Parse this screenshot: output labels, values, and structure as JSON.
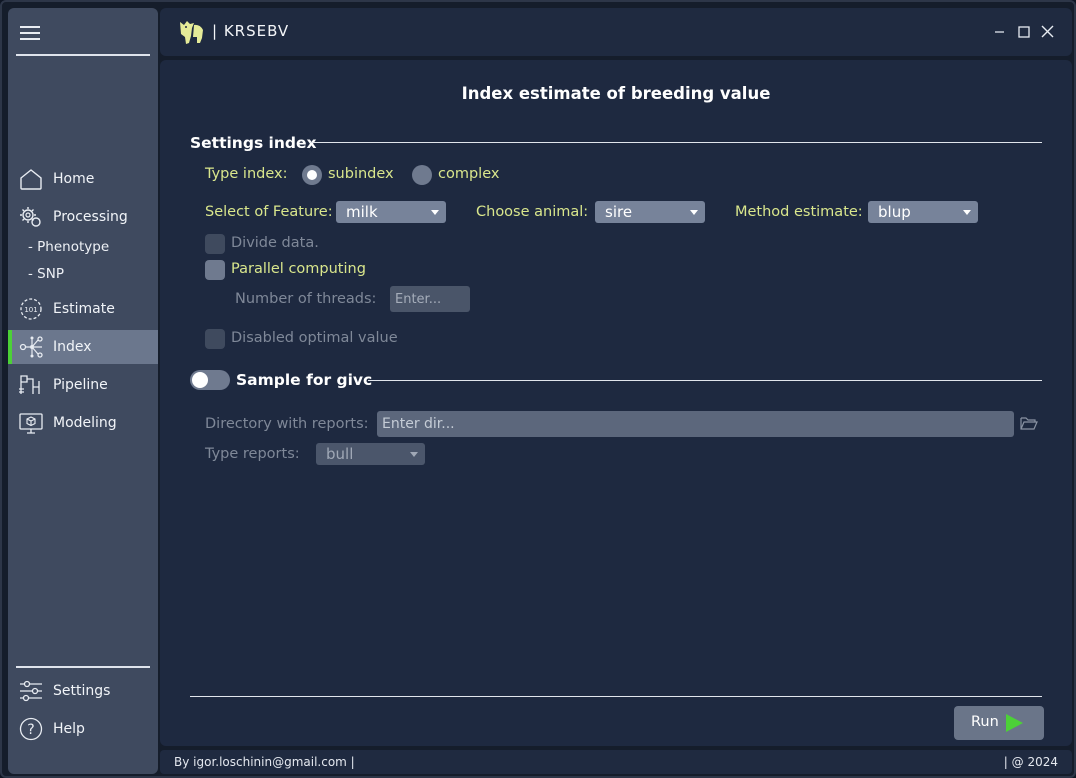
{
  "app": {
    "title": "| KRSEBV"
  },
  "sidebar": {
    "items": [
      {
        "label": "Home",
        "icon": "home-icon"
      },
      {
        "label": "Processing",
        "icon": "gears-icon"
      },
      {
        "label": "Estimate",
        "icon": "estimate-icon"
      },
      {
        "label": "Index",
        "icon": "network-icon",
        "active": true
      },
      {
        "label": "Pipeline",
        "icon": "pipeline-icon"
      },
      {
        "label": "Modeling",
        "icon": "monitor-cube-icon"
      }
    ],
    "sub_items": [
      "- Phenotype",
      "- SNP"
    ],
    "bottom_items": [
      {
        "label": "Settings",
        "icon": "sliders-icon"
      },
      {
        "label": "Help",
        "icon": "help-icon"
      }
    ]
  },
  "main": {
    "page_title": "Index estimate of breeding value",
    "settings_section": {
      "title": "Settings index",
      "type_index_label": "Type index:",
      "type_options": [
        "subindex",
        "complex"
      ],
      "type_selected": "subindex",
      "feature_label": "Select of Feature:",
      "feature_value": "milk",
      "animal_label": "Choose animal:",
      "animal_value": "sire",
      "method_label": "Method estimate:",
      "method_value": "blup",
      "divide_label": "Divide data.",
      "parallel_label": "Parallel computing",
      "threads_label": "Number of threads:",
      "threads_placeholder": "Enter...",
      "optimal_label": "Disabled optimal value"
    },
    "sample_section": {
      "title": "Sample for givc",
      "enabled": false,
      "directory_label": "Directory with reports:",
      "directory_placeholder": "Enter dir...",
      "type_reports_label": "Type reports:",
      "type_reports_value": "bull"
    },
    "run_label": "Run"
  },
  "status": {
    "left": "By igor.loschinin@gmail.com |",
    "right": "| @ 2024"
  },
  "colors": {
    "accent_green": "#4cd137",
    "label_yellow": "#d9e68c",
    "panel_bg": "#1e2940",
    "sidebar_bg": "#3f4a5f"
  }
}
